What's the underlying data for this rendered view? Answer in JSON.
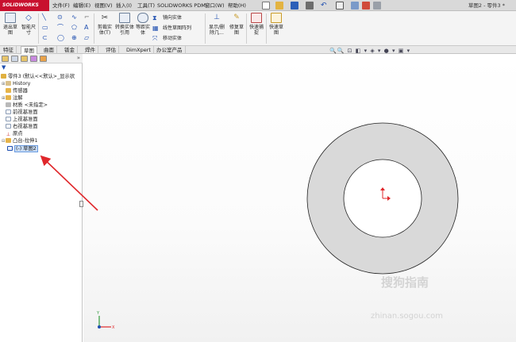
{
  "app": {
    "logo_text": "SOLIDWORKS",
    "window_title": "草图2 - 零件3 *"
  },
  "menubar": {
    "items": [
      "文件(F)",
      "编辑(E)",
      "视图(V)",
      "插入(I)",
      "工具(T)",
      "SOLIDWORKS PDM",
      "窗口(W)",
      "帮助(H)"
    ]
  },
  "ribbon": {
    "exit_sketch": "退出草图",
    "smart_dimension": "智能尺寸",
    "trim_entities": "剪裁实体(T)",
    "convert_entities": "转换实体引用",
    "offset_entities": "等距实体",
    "mirror_entities": "镜向实体",
    "linear_pattern": "线性草图阵列",
    "move_entities": "移动实体",
    "display_delete_relations": "显示/删除几...",
    "repair_sketch": "修复草图",
    "quick_snaps": "快速捕捉",
    "rapid_sketch": "快速草图"
  },
  "tabs": [
    "特征",
    "草图",
    "曲面",
    "钣金",
    "焊件",
    "评估",
    "DimXpert",
    "办公室产品"
  ],
  "active_tab": "草图",
  "tree": {
    "root": "零件3 (默认<<默认>_显示状",
    "items": [
      {
        "label": "History",
        "icon": "history-icon"
      },
      {
        "label": "传感器",
        "icon": "sensor-icon"
      },
      {
        "label": "注解",
        "icon": "annotation-icon"
      },
      {
        "label": "材质 <未指定>",
        "icon": "material-icon"
      },
      {
        "label": "前视基准面",
        "icon": "plane-icon"
      },
      {
        "label": "上视基准面",
        "icon": "plane-icon"
      },
      {
        "label": "右视基准面",
        "icon": "plane-icon"
      },
      {
        "label": "原点",
        "icon": "origin-icon"
      },
      {
        "label": "凸台-拉伸1",
        "icon": "extrude-icon"
      },
      {
        "label": "(-) 草图2",
        "icon": "sketch-icon"
      }
    ]
  },
  "watermark": {
    "brand": "搜狗指南",
    "url": "zhinan.sogou.com"
  },
  "colors": {
    "accent": "#c8102e",
    "ring_fill": "#d9d9d9",
    "arrow": "#e0272b",
    "selection": "#c8dcf5"
  }
}
